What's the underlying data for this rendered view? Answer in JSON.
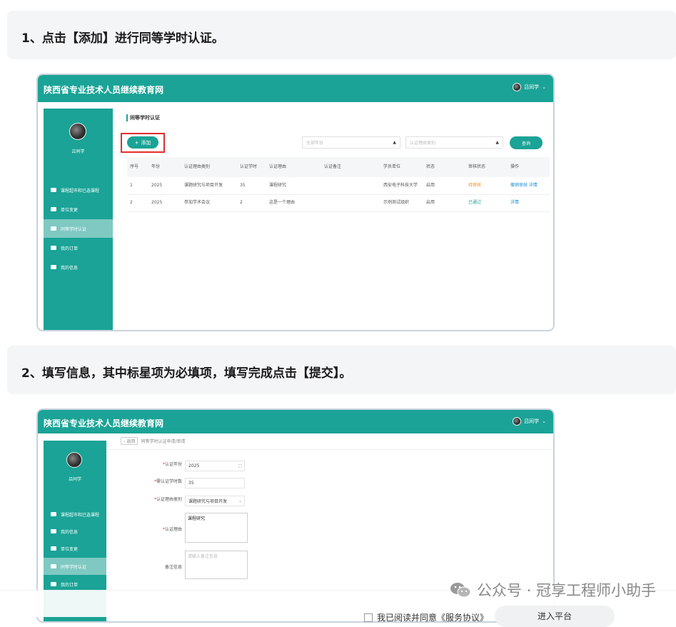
{
  "step1": {
    "text": "1、点击【添加】进行同等学时认证。"
  },
  "step2": {
    "text": "2、填写信息，其中标星项为必填项，填写完成点击【提交】。"
  },
  "shot1": {
    "brand": "陕西省专业技术人员继续教育网",
    "user": "吕同学",
    "sidebar_user": "吕同学",
    "sidebar": [
      {
        "label": "课程超市和已选课程",
        "active": false
      },
      {
        "label": "单位变更",
        "active": false
      },
      {
        "label": "同等学时认证",
        "active": true
      },
      {
        "label": "我的订单",
        "active": false
      },
      {
        "label": "我的信息",
        "active": false
      }
    ],
    "page_title": "同等学时认证",
    "add_label": "添加",
    "year_placeholder": "全部年份",
    "reason_placeholder": "认证理由类别",
    "query_label": "查询",
    "columns": [
      "序号",
      "年份",
      "认证理由类别",
      "认证学时",
      "认证理由",
      "认证备注",
      "学员单位",
      "状态",
      "审核状态",
      "操作"
    ],
    "rows": [
      {
        "no": "1",
        "year": "2025",
        "category": "课题研究与项目开发",
        "hours": "35",
        "reason": "课程研究",
        "note": "",
        "unit": "西安电子科技大学",
        "status": "启用",
        "audit": "待审核",
        "ops": "撤销审核  详情"
      },
      {
        "no": "2",
        "year": "2025",
        "category": "参加学术会议",
        "hours": "2",
        "reason": "这是一个理由",
        "note": "",
        "unit": "示例测试组织",
        "status": "启用",
        "audit": "已通过",
        "ops": "详情"
      }
    ]
  },
  "shot2": {
    "brand": "陕西省专业技术人员继续教育网",
    "user": "吕同学",
    "sidebar_user": "吕同学",
    "sidebar": [
      {
        "label": "课程超市和已选课程",
        "active": false
      },
      {
        "label": "我的信息",
        "active": false
      },
      {
        "label": "单位变更",
        "active": false
      },
      {
        "label": "同等学时认证",
        "active": true
      },
      {
        "label": "我的订单",
        "active": false
      }
    ],
    "back_label": "返回",
    "breadcrumb": "同等学时认证申请/审请",
    "fields": {
      "year_label": "认证年份",
      "year_value": "2025",
      "hours_label": "需认证学时数",
      "hours_value": "35",
      "category_label": "认证理由类别",
      "category_value": "课题研究与项目开发",
      "reason_label": "认证理由",
      "reason_value": "课程研究",
      "note_label": "备注信息",
      "note_placeholder": "请输入备注信息"
    }
  },
  "watermark": "公众号 · 冠享工程师小助手",
  "footer": {
    "checkbox_text": "我已阅读并同意《服务协议》",
    "button": "进入平台"
  },
  "colors": {
    "primary": "#1aa396",
    "highlight": "#e12d2d",
    "pending": "#f08c1c"
  }
}
